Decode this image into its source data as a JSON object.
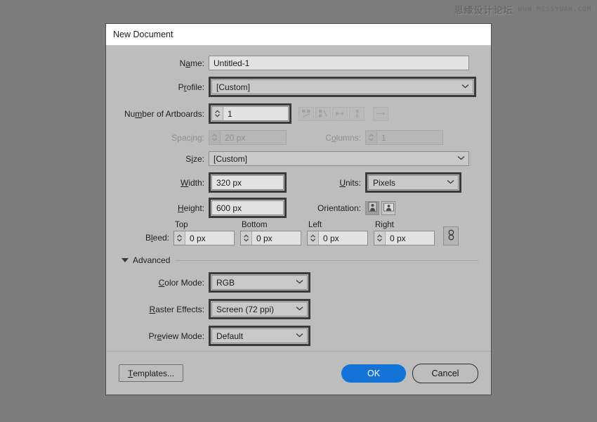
{
  "watermark": {
    "cn_text": "思缘设计论坛",
    "url_text": "WWW.MISSYUAN.COM"
  },
  "dialog": {
    "title": "New Document",
    "fields": {
      "name": {
        "label_pre": "N",
        "label_accel": "a",
        "label_post": "me:",
        "value": "Untitled-1"
      },
      "profile": {
        "label_pre": "P",
        "label_accel": "r",
        "label_post": "ofile:",
        "value": "[Custom]"
      },
      "artboards": {
        "label_pre": "Nu",
        "label_accel": "m",
        "label_post": "ber of Artboards:",
        "value": "1"
      },
      "spacing": {
        "label_pre": "Spac",
        "label_accel": "i",
        "label_post": "ng:",
        "value": "20 px"
      },
      "columns": {
        "label_pre": "C",
        "label_accel": "o",
        "label_post": "lumns:",
        "value": "1"
      },
      "size": {
        "label_pre": "S",
        "label_accel": "i",
        "label_post": "ze:",
        "value": "[Custom]"
      },
      "width": {
        "label_pre": "",
        "label_accel": "W",
        "label_post": "idth:",
        "value": "320 px"
      },
      "height": {
        "label_pre": "",
        "label_accel": "H",
        "label_post": "eight:",
        "value": "600 px"
      },
      "units": {
        "label_pre": "",
        "label_accel": "U",
        "label_post": "nits:",
        "value": "Pixels"
      },
      "orientation": {
        "label": "Orientation:",
        "portrait_name": "portrait",
        "landscape_name": "landscape",
        "selected": "portrait"
      },
      "bleed": {
        "label_pre": "B",
        "label_accel": "l",
        "label_post": "eed:",
        "top_header": "Top",
        "bottom_header": "Bottom",
        "left_header": "Left",
        "right_header": "Right",
        "top_value": "0 px",
        "bottom_value": "0 px",
        "left_value": "0 px",
        "right_value": "0 px",
        "link_name": "link-bleed-values"
      },
      "color_mode": {
        "label_pre": "",
        "label_accel": "C",
        "label_post": "olor Mode:",
        "value": "RGB"
      },
      "raster_effects": {
        "label_pre": "",
        "label_accel": "R",
        "label_post": "aster Effects:",
        "value": "Screen (72 ppi)"
      },
      "preview_mode": {
        "label_pre": "Pr",
        "label_accel": "e",
        "label_post": "view Mode:",
        "value": "Default"
      }
    },
    "advanced": {
      "label": "Advanced",
      "expanded": true
    },
    "arrange_buttons": [
      {
        "name": "grid-by-row-icon"
      },
      {
        "name": "grid-by-column-icon"
      },
      {
        "name": "arrange-by-row-icon"
      },
      {
        "name": "arrange-by-column-icon"
      },
      {
        "name": "change-to-right-to-left-layout-icon"
      }
    ],
    "footer": {
      "templates_pre": "",
      "templates_accel": "T",
      "templates_post": "emplates...",
      "ok_label": "OK",
      "cancel_label": "Cancel"
    }
  },
  "colors": {
    "accent_blue": "#1473d6",
    "dialog_bg": "#bdbdbd",
    "backdrop": "#7d7d7d",
    "titlebar": "#ffffff"
  }
}
